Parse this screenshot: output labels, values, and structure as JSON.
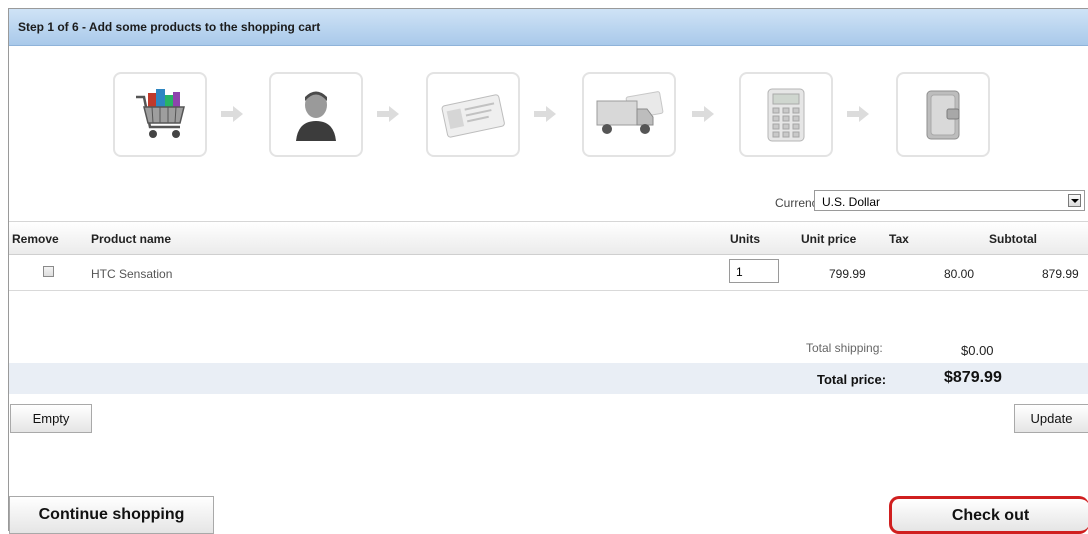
{
  "header": {
    "step_title": "Step 1 of 6 - Add some products to the shopping cart"
  },
  "wizard": {
    "steps": [
      {
        "icon": "shopping-cart-icon"
      },
      {
        "icon": "person-icon"
      },
      {
        "icon": "id-card-icon"
      },
      {
        "icon": "delivery-truck-icon"
      },
      {
        "icon": "calculator-icon"
      },
      {
        "icon": "wallet-icon"
      }
    ]
  },
  "currency": {
    "label": "Currency:",
    "selected": "U.S. Dollar"
  },
  "table": {
    "columns": {
      "remove": "Remove",
      "product_name": "Product name",
      "units": "Units",
      "unit_price": "Unit price",
      "tax": "Tax",
      "subtotal": "Subtotal"
    },
    "rows": [
      {
        "product_name": "HTC Sensation",
        "units": "1",
        "unit_price": "799.99",
        "tax": "80.00",
        "subtotal": "879.99"
      }
    ]
  },
  "totals": {
    "shipping_label": "Total shipping:",
    "shipping_value": "$0.00",
    "price_label": "Total price:",
    "price_value": "$879.99"
  },
  "buttons": {
    "empty": "Empty",
    "update": "Update",
    "continue_shopping": "Continue shopping",
    "check_out": "Check out"
  },
  "colors": {
    "header_gradient_top": "#cfe3f6",
    "header_gradient_bottom": "#a9c9ea",
    "total_band": "#e9eef5",
    "checkout_highlight": "#d01f1f"
  }
}
